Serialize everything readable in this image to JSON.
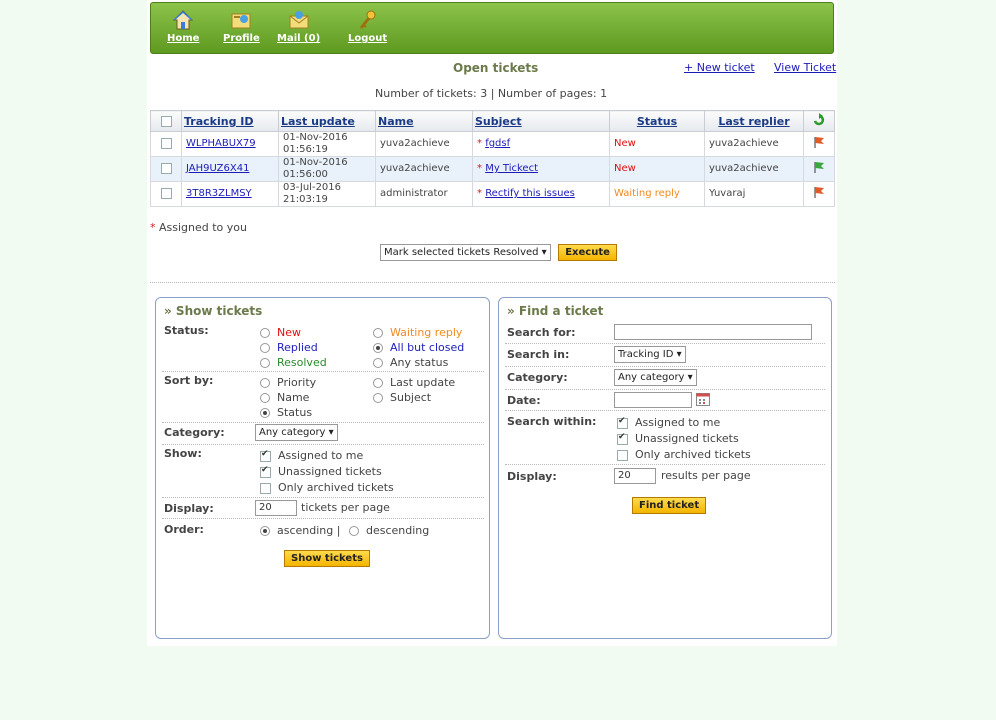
{
  "nav": [
    {
      "label": "Home",
      "icon": "home-icon"
    },
    {
      "label": "Profile",
      "icon": "profile-icon"
    },
    {
      "label": "Mail (0)",
      "icon": "mail-icon"
    },
    {
      "label": "Logout",
      "icon": "key-icon"
    }
  ],
  "header": {
    "title": "Open tickets",
    "new_ticket": "+ New ticket",
    "view_ticket": "View Ticket",
    "counts": "Number of tickets: 3 | Number of pages: 1"
  },
  "table": {
    "columns": [
      "Tracking ID",
      "Last update",
      "Name",
      "Subject",
      "Status",
      "Last replier"
    ],
    "rows": [
      {
        "id": "WLPHABUX79",
        "date": "01-Nov-2016",
        "time": "01:56:19",
        "name": "yuva2achieve",
        "star": "*",
        "subject": "fgdsf",
        "status": "New",
        "replier": "yuva2achieve",
        "flag_color": "#e05a2a"
      },
      {
        "id": "JAH9UZ6X41",
        "date": "01-Nov-2016",
        "time": "01:56:00",
        "name": "yuva2achieve",
        "star": "*",
        "subject": "My Tickect",
        "status": "New",
        "replier": "yuva2achieve",
        "flag_color": "#38a83a"
      },
      {
        "id": "3T8R3ZLMSY",
        "date": "03-Jul-2016",
        "time": "21:03:19",
        "name": "administrator",
        "star": "*",
        "subject": "Rectify this issues",
        "status": "Waiting reply",
        "replier": "Yuvaraj",
        "flag_color": "#e05a2a"
      }
    ]
  },
  "assigned_note": {
    "star": "*",
    "text": " Assigned to you"
  },
  "bulk": {
    "select": "Mark selected tickets Resolved",
    "execute": "Execute"
  },
  "show": {
    "title": "» Show tickets",
    "status_label": "Status:",
    "status": {
      "new": "New",
      "waiting": "Waiting reply",
      "replied": "Replied",
      "all_but_closed": "All but closed",
      "resolved": "Resolved",
      "any": "Any status"
    },
    "sort_label": "Sort by:",
    "sort": {
      "priority": "Priority",
      "last_update": "Last update",
      "name": "Name",
      "subject": "Subject",
      "status": "Status"
    },
    "category_label": "Category:",
    "category": "Any category",
    "show_label": "Show:",
    "show": {
      "assigned": "Assigned to me",
      "unassigned": "Unassigned tickets",
      "archived": "Only archived tickets"
    },
    "display_label": "Display:",
    "display_value": "20",
    "display_suffix": "tickets per page",
    "order_label": "Order:",
    "order": {
      "asc": "ascending |",
      "desc": "descending"
    },
    "button": "Show tickets"
  },
  "find": {
    "title": "» Find a ticket",
    "search_for_label": "Search for:",
    "search_for_value": "",
    "search_in_label": "Search in:",
    "search_in": "Tracking ID",
    "category_label": "Category:",
    "category": "Any category",
    "date_label": "Date:",
    "date_value": "",
    "within_label": "Search within:",
    "within": {
      "assigned": "Assigned to me",
      "unassigned": "Unassigned tickets",
      "archived": "Only archived tickets"
    },
    "display_label": "Display:",
    "display_value": "20",
    "display_suffix": "results per page",
    "button": "Find ticket"
  },
  "colors": {
    "nav_bar": "#6fa82f",
    "link": "#1b1bb8",
    "status_new": "#e01010",
    "status_waiting": "#f08a20",
    "replied": "#2020c0",
    "resolved": "#2a8a2a",
    "button": "#f4b400"
  }
}
